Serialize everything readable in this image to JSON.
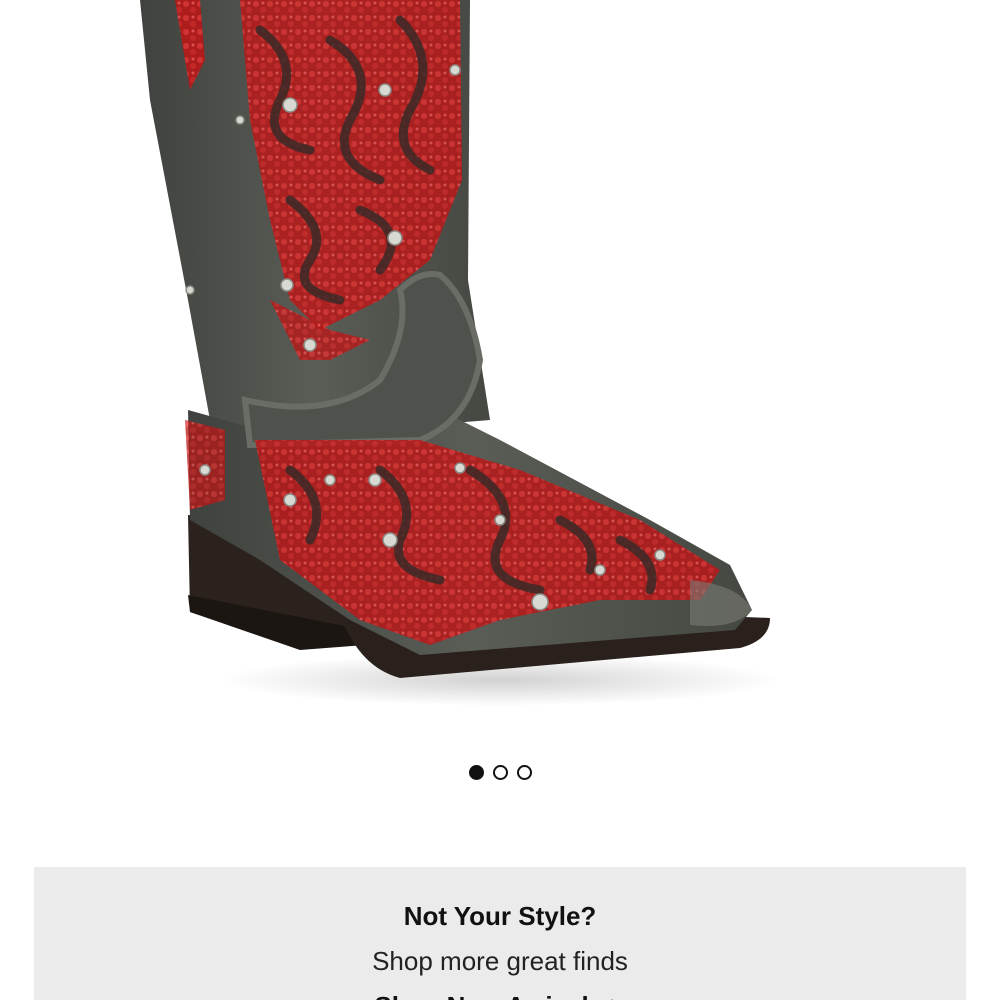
{
  "product": {
    "image_alt": "Red sequin embroidered cowboy boot",
    "carousel": {
      "total": 3,
      "active_index": 0
    }
  },
  "promo": {
    "title": "Not Your Style?",
    "subtitle": "Shop more great finds",
    "link_label": "Shop New Arrivals >"
  },
  "colors": {
    "boot_leather": "#4a4d48",
    "sequin_red": "#c41a1a",
    "sole_dark": "#2a211d",
    "promo_bg": "#ebebeb"
  }
}
